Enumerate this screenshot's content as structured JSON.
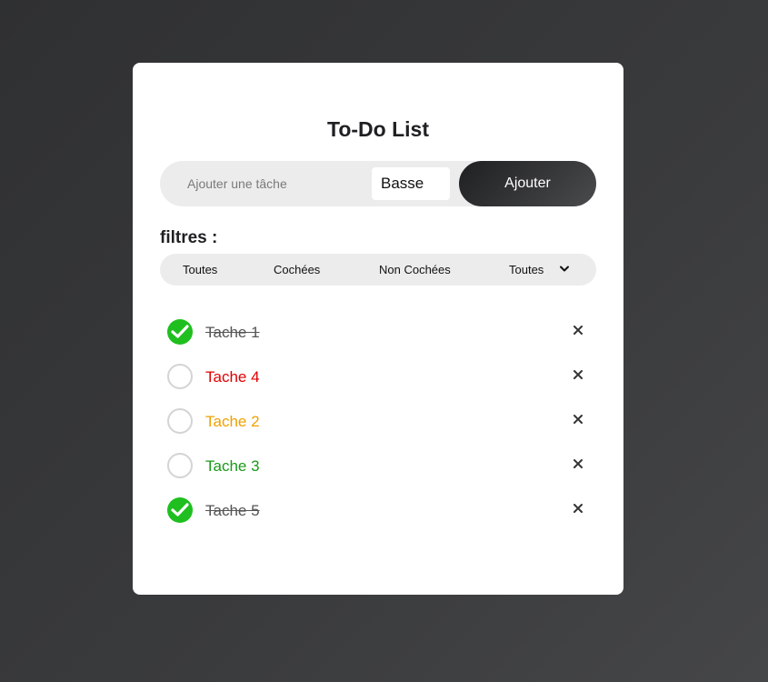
{
  "app": {
    "title": "To-Do List"
  },
  "add_form": {
    "input_placeholder": "Ajouter une tâche",
    "input_value": "",
    "priority_selected": "Basse",
    "add_label": "Ajouter"
  },
  "filters": {
    "label": "filtres :",
    "buttons": [
      "Toutes",
      "Cochées",
      "Non Cochées"
    ],
    "priority_selected": "Toutes"
  },
  "colors": {
    "accent_check": "#1fbf1f",
    "priority_high": "#e00000",
    "priority_medium": "#f0a000",
    "priority_low": "#1a9a1a",
    "done_text": "#555555"
  },
  "tasks": [
    {
      "label": "Tache 1",
      "checked": true,
      "color": "#555555"
    },
    {
      "label": "Tache 4",
      "checked": false,
      "color": "#e00000"
    },
    {
      "label": "Tache 2",
      "checked": false,
      "color": "#f0a000"
    },
    {
      "label": "Tache 3",
      "checked": false,
      "color": "#1a9a1a"
    },
    {
      "label": "Tache 5",
      "checked": true,
      "color": "#555555"
    }
  ],
  "icons": {
    "check": "check-icon",
    "delete": "close-icon",
    "dropdown": "chevron-down-icon"
  }
}
